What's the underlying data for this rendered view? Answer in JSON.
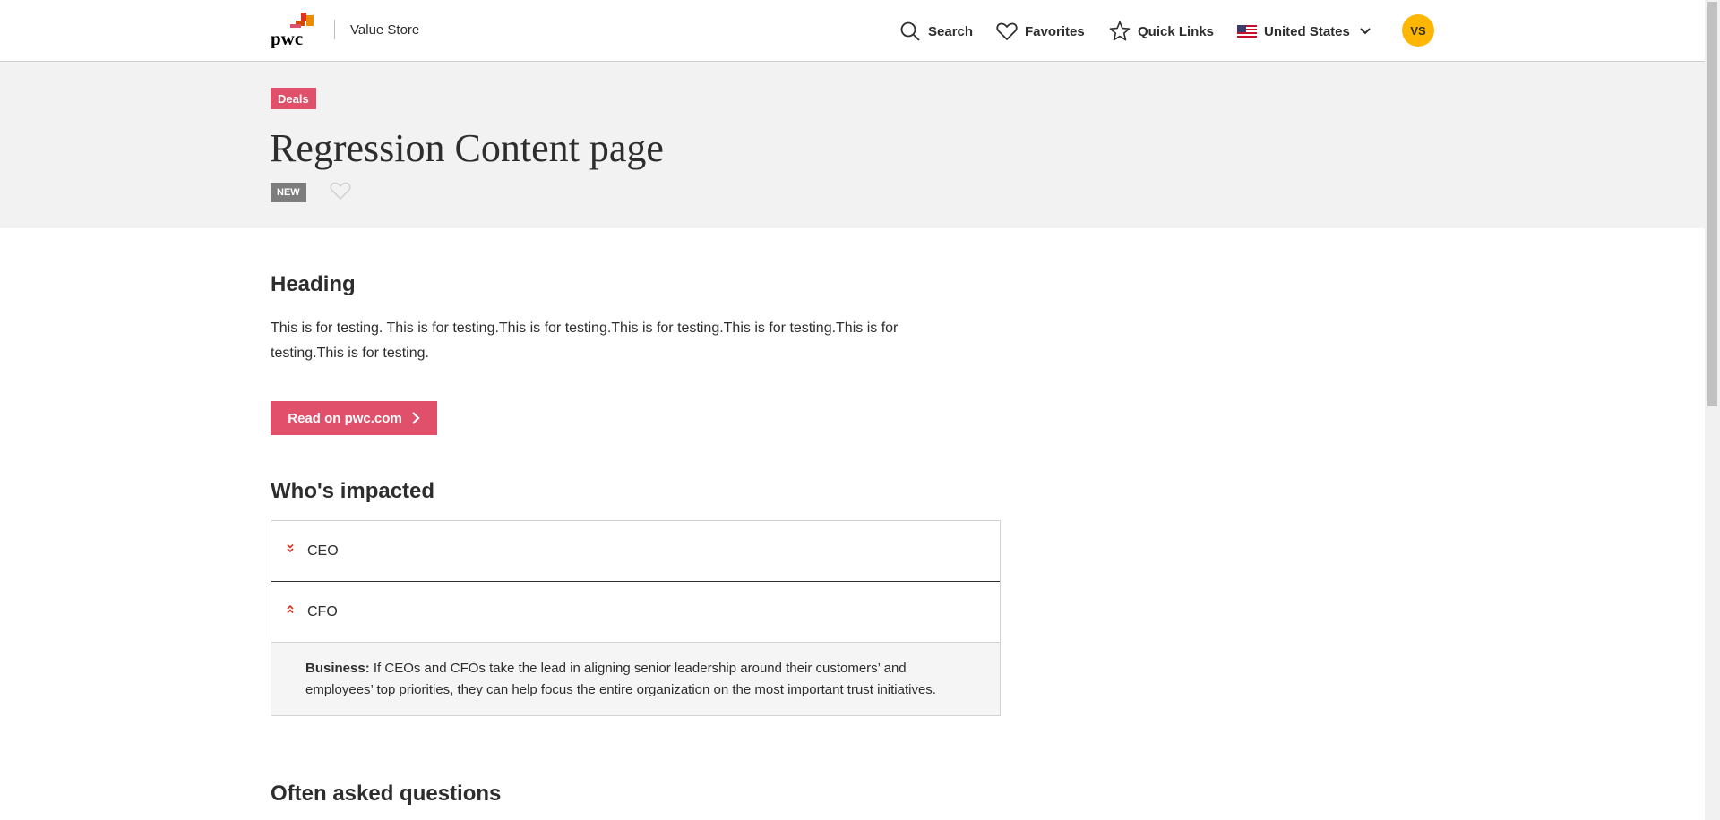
{
  "header": {
    "logo_text": "pwc",
    "site_name": "Value Store",
    "nav": {
      "search": "Search",
      "favorites": "Favorites",
      "quick_links": "Quick Links",
      "country": "United States"
    },
    "user_initials": "VS"
  },
  "hero": {
    "category_tag": "Deals",
    "title": "Regression Content page",
    "badge": "NEW"
  },
  "content": {
    "heading": "Heading",
    "body": "This is for testing. This is for testing.This is for testing.This is for testing.This is for testing.This is for testing.This is for testing.",
    "cta_label": "Read on pwc.com",
    "impacted_heading": "Who's impacted",
    "impacted": [
      {
        "label": "CEO",
        "expanded": false
      },
      {
        "label": "CFO",
        "expanded": true
      }
    ],
    "cfo_panel": {
      "lead": "Business:",
      "text": " If CEOs and CFOs take the lead in aligning senior leadership around their customers’ and employees’ top priorities, they can help focus the entire organization on the most important trust initiatives."
    },
    "faq_heading": "Often asked questions"
  },
  "colors": {
    "accent": "#e0506a",
    "avatar": "#ffb600",
    "hero_bg": "#f2f2f2",
    "badge_bg": "#7d7d7d"
  },
  "icons": [
    "pwc-logo",
    "search-icon",
    "heart-icon",
    "star-icon",
    "us-flag-icon",
    "chevron-down-icon",
    "chevron-right-icon",
    "double-chevron-down-icon",
    "double-chevron-up-icon"
  ]
}
